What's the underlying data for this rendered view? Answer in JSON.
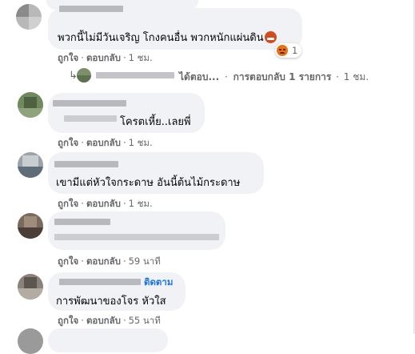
{
  "comments": [
    {
      "text": "พวกนี้ไม่มีวันเจริญ โกงคนอื่น พวกหนักแผ่นดิน",
      "emoji": "angry-face-emoji",
      "reaction_count": "1",
      "actions": {
        "like": "ถูกใจ",
        "reply": "ตอบกลับ",
        "time": "1 ชม."
      },
      "reply_thread": {
        "replied_text": "ได้ตอบ...",
        "replies_label": "การตอบกลับ 1 รายการ",
        "time": "1 ชม."
      }
    },
    {
      "text": "โครตเหี้ย..เลยพี่",
      "actions": {
        "like": "ถูกใจ",
        "reply": "ตอบกลับ",
        "time": "1 ชม."
      }
    },
    {
      "text": "เขามีแต่หัวใจกระดาษ อันนี้ต้นไม้กระดาษ",
      "actions": {
        "like": "ถูกใจ",
        "reply": "ตอบกลับ",
        "time": "1 ชม."
      }
    },
    {
      "text": "",
      "actions": {
        "like": "ถูกใจ",
        "reply": "ตอบกลับ",
        "time": "59 นาที"
      }
    },
    {
      "follow_label": "ติดตาม",
      "text": "การพัฒนาของโจร หัวใส",
      "actions": {
        "like": "ถูกใจ",
        "reply": "ตอบกลับ",
        "time": "55 นาที"
      }
    }
  ],
  "separator": "·",
  "reply_arrow": "↳",
  "colors": {
    "bubble": "#f0f2f5",
    "meta": "#65676b",
    "link": "#1b74e4",
    "angry": "#e9710f"
  }
}
